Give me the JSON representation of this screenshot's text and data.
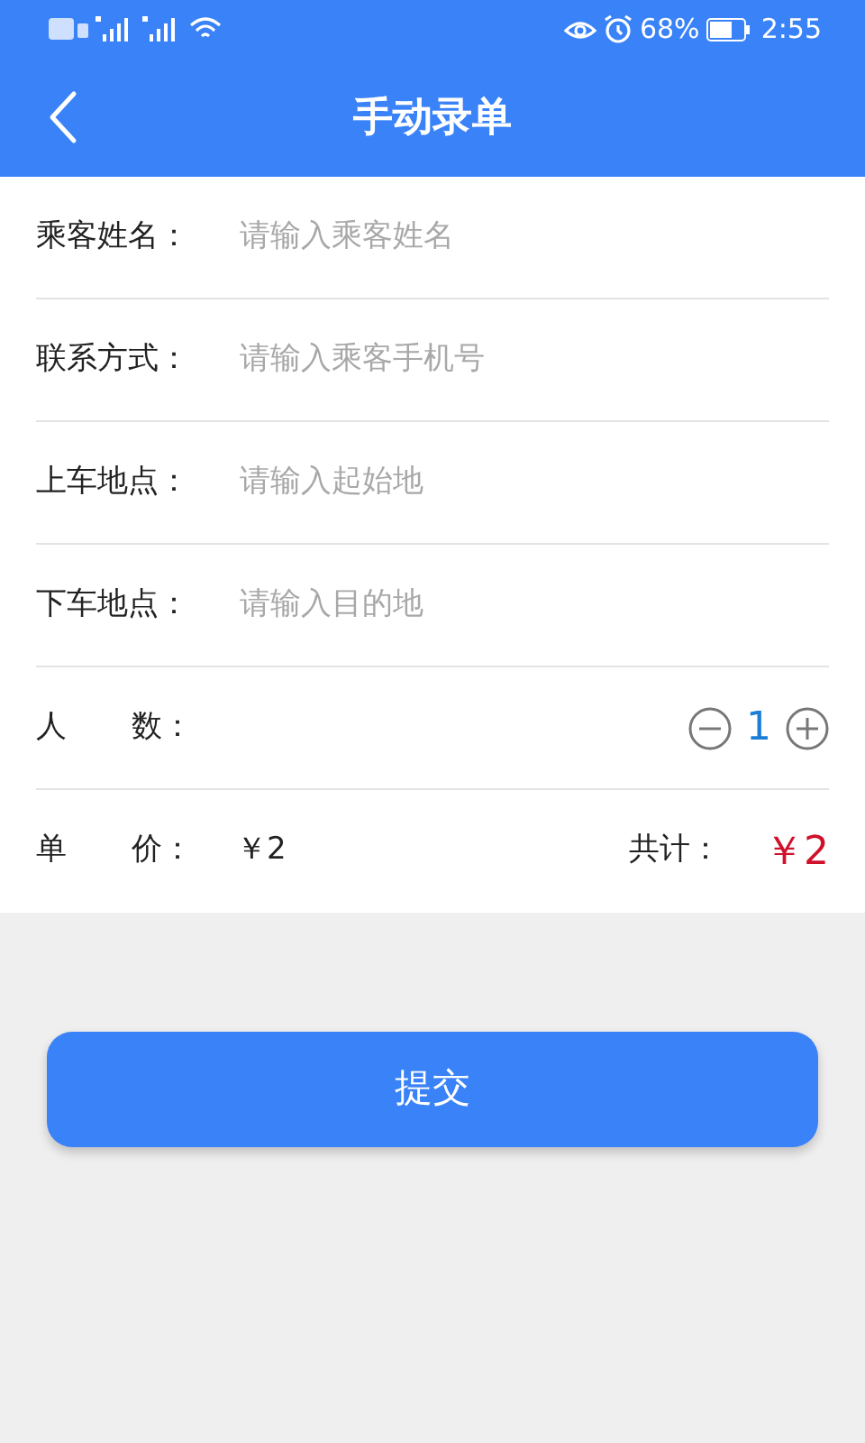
{
  "status_bar": {
    "battery_text": "68%",
    "time": "2:55"
  },
  "header": {
    "title": "手动录单"
  },
  "fields": [
    {
      "label": "乘客姓名：",
      "placeholder": "请输入乘客姓名"
    },
    {
      "label": "联系方式：",
      "placeholder": "请输入乘客手机号"
    },
    {
      "label": "上车地点：",
      "placeholder": "请输入起始地"
    },
    {
      "label": "下车地点：",
      "placeholder": "请输入目的地"
    }
  ],
  "count": {
    "label_parts": [
      "人",
      "数："
    ],
    "value": "1"
  },
  "price": {
    "label_parts": [
      "单",
      "价："
    ],
    "unit_price": "￥2",
    "total_label": "共计：",
    "total": "￥2"
  },
  "submit": {
    "label": "提交"
  }
}
